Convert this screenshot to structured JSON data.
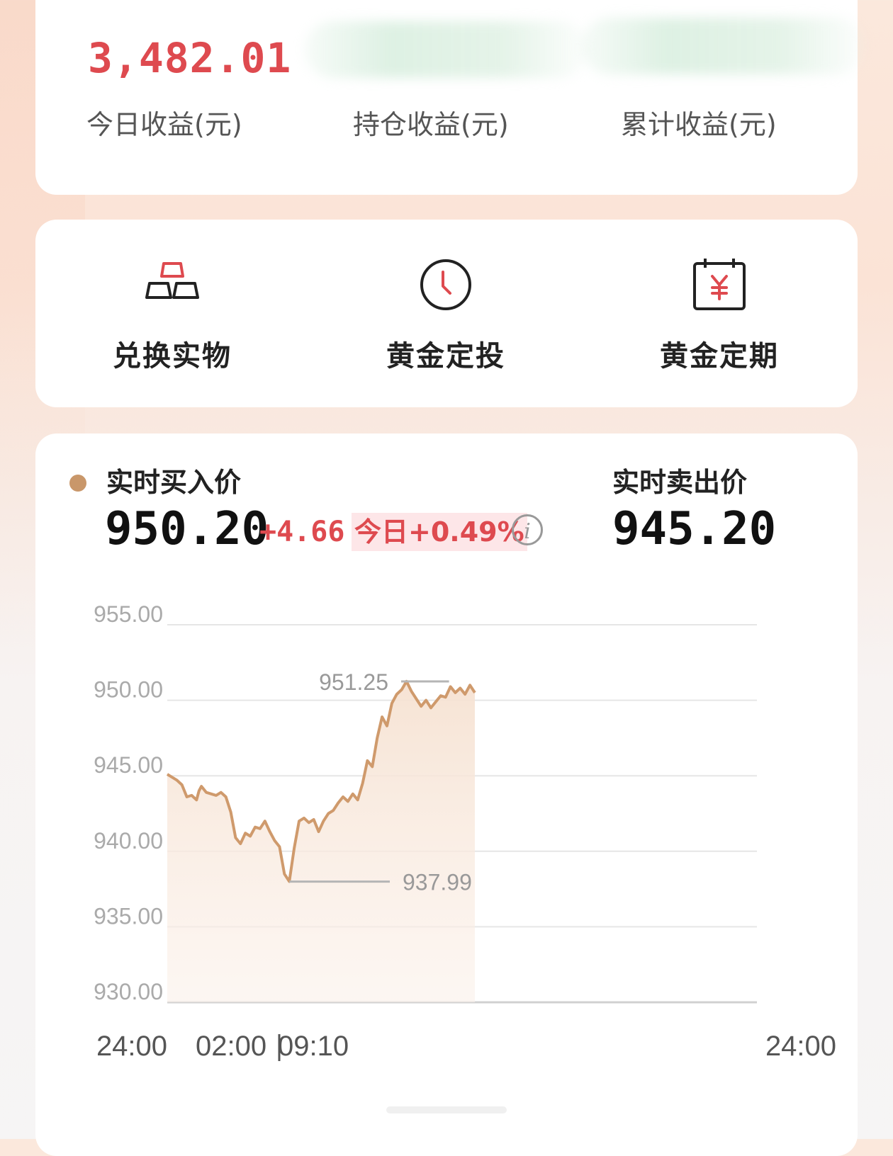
{
  "earnings": {
    "today_value": "3,482.01",
    "today_label": "今日收益(元)",
    "holding_label": "持仓收益(元)",
    "total_label": "累计收益(元)"
  },
  "actions": [
    {
      "label": "兑换实物",
      "icon": "gold-bars-icon"
    },
    {
      "label": "黄金定投",
      "icon": "clock-icon"
    },
    {
      "label": "黄金定期",
      "icon": "yuan-calendar-icon"
    }
  ],
  "price": {
    "buy_title": "实时买入价",
    "buy_value": "950.20",
    "change": "+4.66",
    "change_pct": "今日+0.49%",
    "sell_title": "实时卖出价",
    "sell_value": "945.20"
  },
  "colors": {
    "accent_red": "#de4a4f",
    "line": "#cf9a6c",
    "fill": "#f6e2d2"
  },
  "chart_data": {
    "type": "line",
    "ylim": [
      930,
      955
    ],
    "yticks": [
      "955.00",
      "950.00",
      "945.00",
      "940.00",
      "935.00",
      "930.00"
    ],
    "x_labels": [
      "24:00",
      "02:00",
      "09:10",
      "24:00"
    ],
    "max_label": "951.25",
    "min_label": "937.99",
    "max": 951.25,
    "min": 937.99,
    "x": [
      0,
      1,
      2,
      3,
      4,
      5,
      6,
      6.5,
      7,
      8,
      9,
      10,
      11,
      12,
      13,
      14,
      15,
      16,
      17,
      18,
      19,
      20,
      21,
      22,
      23,
      24,
      25,
      26,
      27,
      28,
      29,
      30,
      31,
      32,
      33,
      34,
      35,
      36,
      37,
      38,
      39,
      40,
      41,
      42,
      43,
      44,
      45,
      46,
      47,
      48,
      49,
      50,
      51,
      52,
      53,
      54,
      55,
      56,
      57,
      58,
      59,
      60,
      61,
      62,
      63
    ],
    "series": [
      {
        "values": [
          945.1,
          944.9,
          944.7,
          944.4,
          943.6,
          943.7,
          943.4,
          944.0,
          944.3,
          943.9,
          943.8,
          943.7,
          943.9,
          943.6,
          942.6,
          940.9,
          940.5,
          941.2,
          941.0,
          941.6,
          941.5,
          942.0,
          941.3,
          940.7,
          940.3,
          938.5,
          938.0,
          940.2,
          942.0,
          942.2,
          941.9,
          942.1,
          941.3,
          942.0,
          942.5,
          942.7,
          943.2,
          943.6,
          943.3,
          943.8,
          943.4,
          944.5,
          946.0,
          945.6,
          947.5,
          948.9,
          948.3,
          949.8,
          950.4,
          950.7,
          951.25,
          950.6,
          950.1,
          949.6,
          950.0,
          949.5,
          949.9,
          950.3,
          950.2,
          950.9,
          950.5,
          950.8,
          950.4,
          951.0,
          950.5
        ]
      }
    ]
  }
}
